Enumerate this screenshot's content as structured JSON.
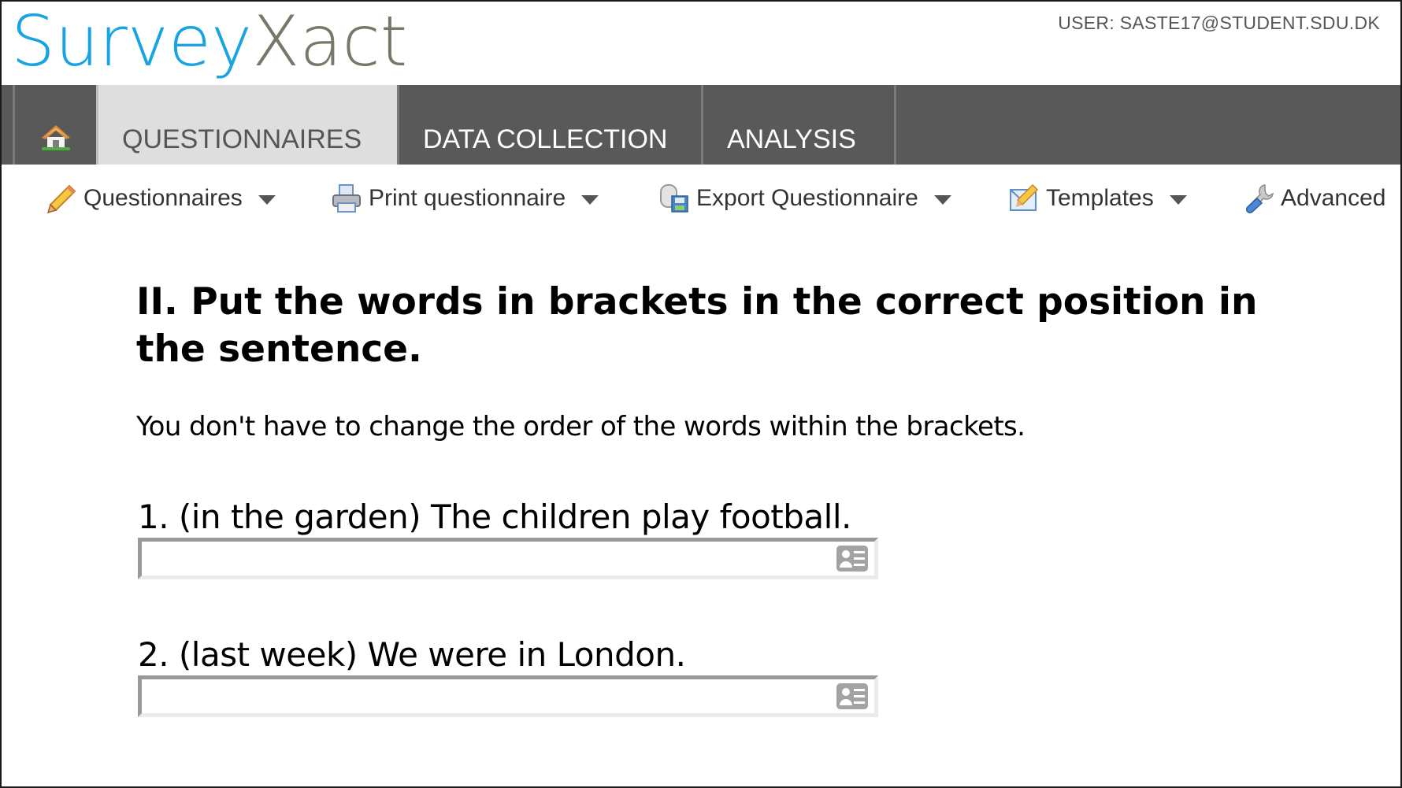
{
  "header": {
    "logo_part1": "Survey",
    "logo_part2": "Xact",
    "user_label": "USER: SASTE17@STUDENT.SDU.DK",
    "colors": {
      "logo_blue": "#1aa3e3",
      "logo_gray": "#7a776a",
      "nav_bg": "#595959",
      "nav_active": "#dedede"
    }
  },
  "nav": {
    "home_icon": "home-icon",
    "tabs": [
      {
        "label": "QUESTIONNAIRES",
        "active": true
      },
      {
        "label": "DATA COLLECTION",
        "active": false
      },
      {
        "label": "ANALYSIS",
        "active": false
      }
    ]
  },
  "toolbar": {
    "items": [
      {
        "label": "Questionnaires",
        "icon": "pencil-icon",
        "dropdown": true
      },
      {
        "label": "Print questionnaire",
        "icon": "printer-icon",
        "dropdown": true
      },
      {
        "label": "Export Questionnaire",
        "icon": "export-save-icon",
        "dropdown": true
      },
      {
        "label": "Templates",
        "icon": "template-edit-icon",
        "dropdown": true
      },
      {
        "label": "Advanced",
        "icon": "wrench-icon",
        "dropdown": false
      }
    ]
  },
  "content": {
    "heading": "II. Put the words in brackets in the correct position in the sentence.",
    "instruction": "You don't have to change the order of the words within the brackets.",
    "questions": [
      {
        "label": "1. (in the garden) The children play football.",
        "value": "",
        "placeholder": ""
      },
      {
        "label": "2. (last week) We were in London.",
        "value": "",
        "placeholder": ""
      }
    ]
  }
}
